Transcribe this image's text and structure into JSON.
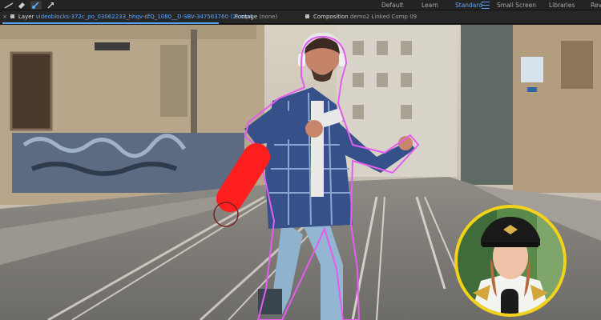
{
  "workspaces": {
    "items": [
      {
        "label": "Default",
        "active": false
      },
      {
        "label": "Learn",
        "active": false
      },
      {
        "label": "Standard",
        "active": true
      },
      {
        "label": "Small Screen",
        "active": false
      },
      {
        "label": "Libraries",
        "active": false
      },
      {
        "label": "Rev",
        "active": false
      }
    ]
  },
  "tabs": {
    "layer": {
      "label": "Layer",
      "value": "videoblocks-372c_po_03062233_hhqv-dfQ_1080__D-SBV-347563760 (2).mp4"
    },
    "footage": {
      "label": "Footage",
      "value": "(none)"
    },
    "composition": {
      "label": "Composition",
      "value": "demo2 Linked Comp 09"
    }
  },
  "colors": {
    "accent": "#5aa6ff",
    "roto_outline": "#e65cf2",
    "brush_stroke": "#ff1f1f",
    "inset_ring": "#f2d21b"
  },
  "icons": [
    "eraser-icon",
    "roto-brush-icon",
    "refine-edge-icon",
    "puppet-pin-icon"
  ]
}
